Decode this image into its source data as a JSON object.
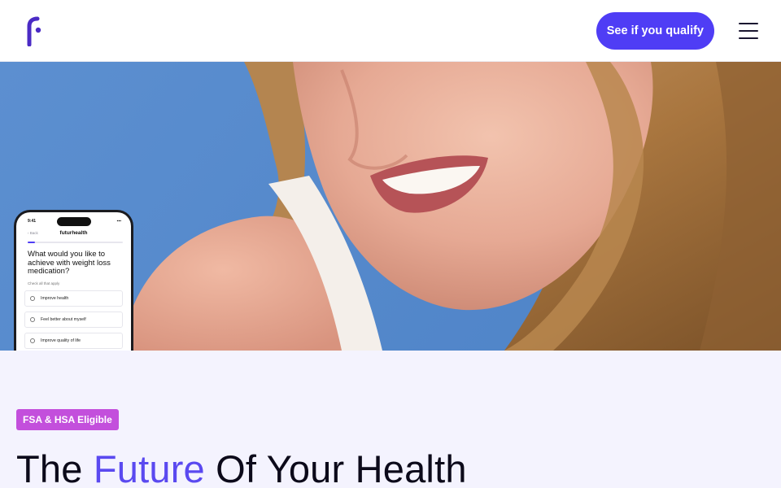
{
  "header": {
    "logo_alt": "fuller health logo",
    "cta_label": "See if you qualify",
    "menu_label": "Menu"
  },
  "hero": {
    "phone": {
      "status_time": "9:41",
      "back_label": "Back",
      "brand": "futurhealth",
      "progress": 0.08,
      "question": "What would you like to achieve with weight loss medication?",
      "hint": "Check all that apply",
      "options": [
        "Improve health",
        "Feel better about myself",
        "Improve quality of life"
      ]
    }
  },
  "content": {
    "badge": "FSA & HSA Eligible",
    "headline_part1": "The ",
    "headline_accent": "Future",
    "headline_part2": " Of Your Health"
  },
  "colors": {
    "brand_purple": "#4f3df5",
    "accent_text": "#5a49f0",
    "badge_magenta": "#c34fdc",
    "section_bg": "#f4f3fe"
  }
}
